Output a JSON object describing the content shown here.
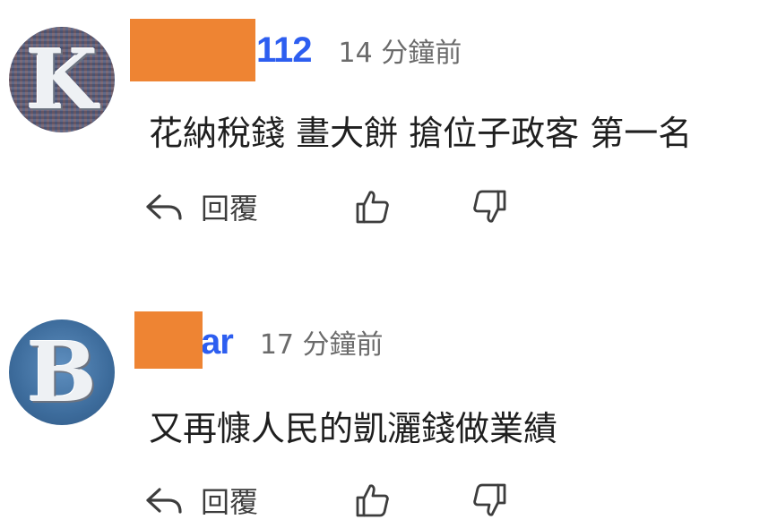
{
  "comments": [
    {
      "avatar_letter": "K",
      "username": "112",
      "timestamp": "14 分鐘前",
      "text": "花納稅錢 畫大餅 搶位子政客 第一名",
      "reply_label": "回覆",
      "icons": {
        "reply": "reply-arrow-icon",
        "like": "thumbs-up-icon",
        "dislike": "thumbs-down-icon"
      }
    },
    {
      "avatar_letter": "B",
      "username": "ar",
      "timestamp": "17 分鐘前",
      "text": "又再慷人民的凱灑錢做業績",
      "reply_label": "回覆",
      "icons": {
        "reply": "reply-arrow-icon",
        "like": "thumbs-up-icon",
        "dislike": "thumbs-down-icon"
      }
    }
  ],
  "colors": {
    "username": "#2d5ef0",
    "timestamp": "#6b6b6b",
    "redaction": "#ee8433",
    "text": "#1f1f1f",
    "icon": "#3d3d3d"
  }
}
